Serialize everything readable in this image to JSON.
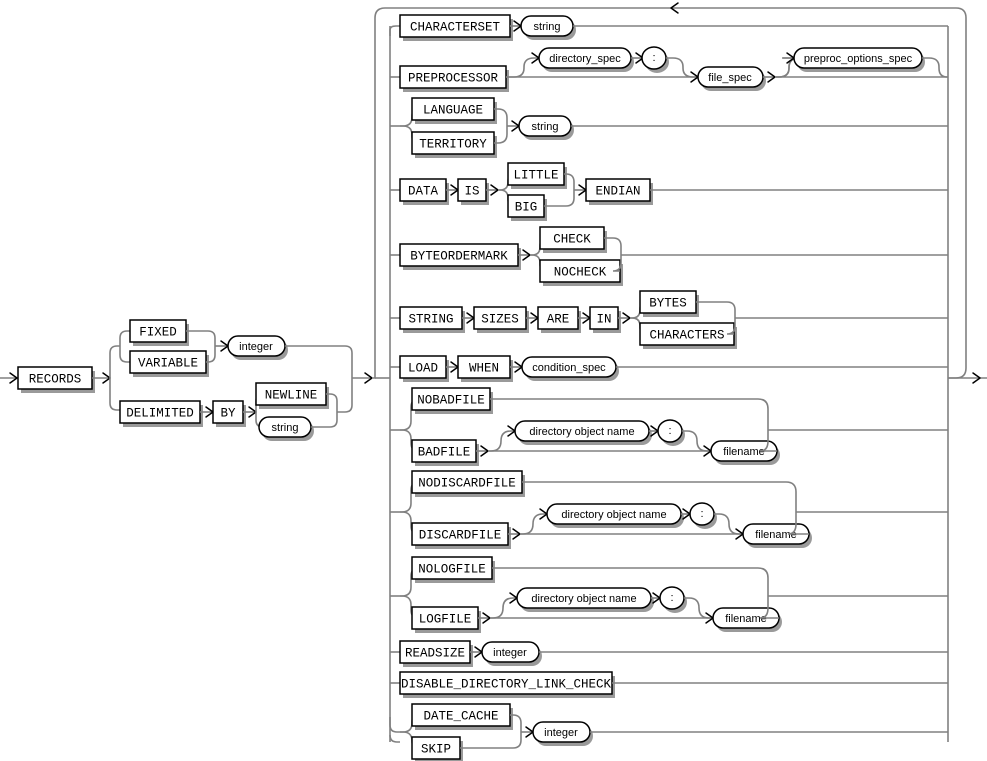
{
  "diagram": {
    "name": "record_format_info",
    "title": "record_format_info clause syntax diagram",
    "type": "railroad-syntax-diagram",
    "colors": {
      "line": "#808080",
      "ink": "#000000",
      "shadow": "#9a9a9a",
      "background": "#ffffff"
    },
    "entry_label": "RECORDS",
    "nodes": {
      "records": "RECORDS",
      "fixed": "FIXED",
      "variable": "VARIABLE",
      "integer1": "integer",
      "delimited": "DELIMITED",
      "by": "BY",
      "newline": "NEWLINE",
      "string_delim": "string",
      "characterset": "CHARACTERSET",
      "string_cs": "string",
      "preprocessor": "PREPROCESSOR",
      "directory_spec": "directory_spec",
      "colon1": ":",
      "file_spec": "file_spec",
      "preproc_options_spec": "preproc_options_spec",
      "language": "LANGUAGE",
      "territory": "TERRITORY",
      "string_lang": "string",
      "data": "DATA",
      "is": "IS",
      "little": "LITTLE",
      "big": "BIG",
      "endian": "ENDIAN",
      "byteordermark": "BYTEORDERMARK",
      "check": "CHECK",
      "nocheck": "NOCHECK",
      "string_kw": "STRING",
      "sizes": "SIZES",
      "are": "ARE",
      "in": "IN",
      "bytes": "BYTES",
      "characters": "CHARACTERS",
      "load": "LOAD",
      "when": "WHEN",
      "condition_spec": "condition_spec",
      "nobadfile": "NOBADFILE",
      "badfile": "BADFILE",
      "dir_obj_bad": "directory object name",
      "colon_bad": ":",
      "filename_bad": "filename",
      "nodiscardfile": "NODISCARDFILE",
      "discardfile": "DISCARDFILE",
      "dir_obj_dis": "directory object name",
      "colon_dis": ":",
      "filename_dis": "filename",
      "nologfile": "NOLOGFILE",
      "logfile": "LOGFILE",
      "dir_obj_log": "directory object name",
      "colon_log": ":",
      "filename_log": "filename",
      "readsize": "READSIZE",
      "integer_read": "integer",
      "disable_directory_link_check": "DISABLE_DIRECTORY_LINK_CHECK",
      "date_cache": "DATE_CACHE",
      "skip": "SKIP",
      "integer_dc": "integer"
    },
    "alternative_rows": [
      {
        "id": "characterset",
        "labels": [
          "CHARACTERSET",
          "string"
        ]
      },
      {
        "id": "preprocessor",
        "labels": [
          "PREPROCESSOR",
          "directory_spec",
          ":",
          "file_spec",
          "preproc_options_spec"
        ]
      },
      {
        "id": "language-territory",
        "labels": [
          "LANGUAGE",
          "TERRITORY",
          "string"
        ]
      },
      {
        "id": "data-endian",
        "labels": [
          "DATA",
          "IS",
          "LITTLE",
          "BIG",
          "ENDIAN"
        ]
      },
      {
        "id": "byteordermark",
        "labels": [
          "BYTEORDERMARK",
          "CHECK",
          "NOCHECK"
        ]
      },
      {
        "id": "string-sizes",
        "labels": [
          "STRING",
          "SIZES",
          "ARE",
          "IN",
          "BYTES",
          "CHARACTERS"
        ]
      },
      {
        "id": "load-when",
        "labels": [
          "LOAD",
          "WHEN",
          "condition_spec"
        ]
      },
      {
        "id": "badfile",
        "labels": [
          "NOBADFILE",
          "BADFILE",
          "directory object name",
          ":",
          "filename"
        ]
      },
      {
        "id": "discardfile",
        "labels": [
          "NODISCARDFILE",
          "DISCARDFILE",
          "directory object name",
          ":",
          "filename"
        ]
      },
      {
        "id": "logfile",
        "labels": [
          "NOLOGFILE",
          "LOGFILE",
          "directory object name",
          ":",
          "filename"
        ]
      },
      {
        "id": "readsize",
        "labels": [
          "READSIZE",
          "integer"
        ]
      },
      {
        "id": "disable-link-check",
        "labels": [
          "DISABLE_DIRECTORY_LINK_CHECK"
        ]
      },
      {
        "id": "date-cache-skip",
        "labels": [
          "DATE_CACHE",
          "SKIP",
          "integer"
        ]
      }
    ]
  }
}
